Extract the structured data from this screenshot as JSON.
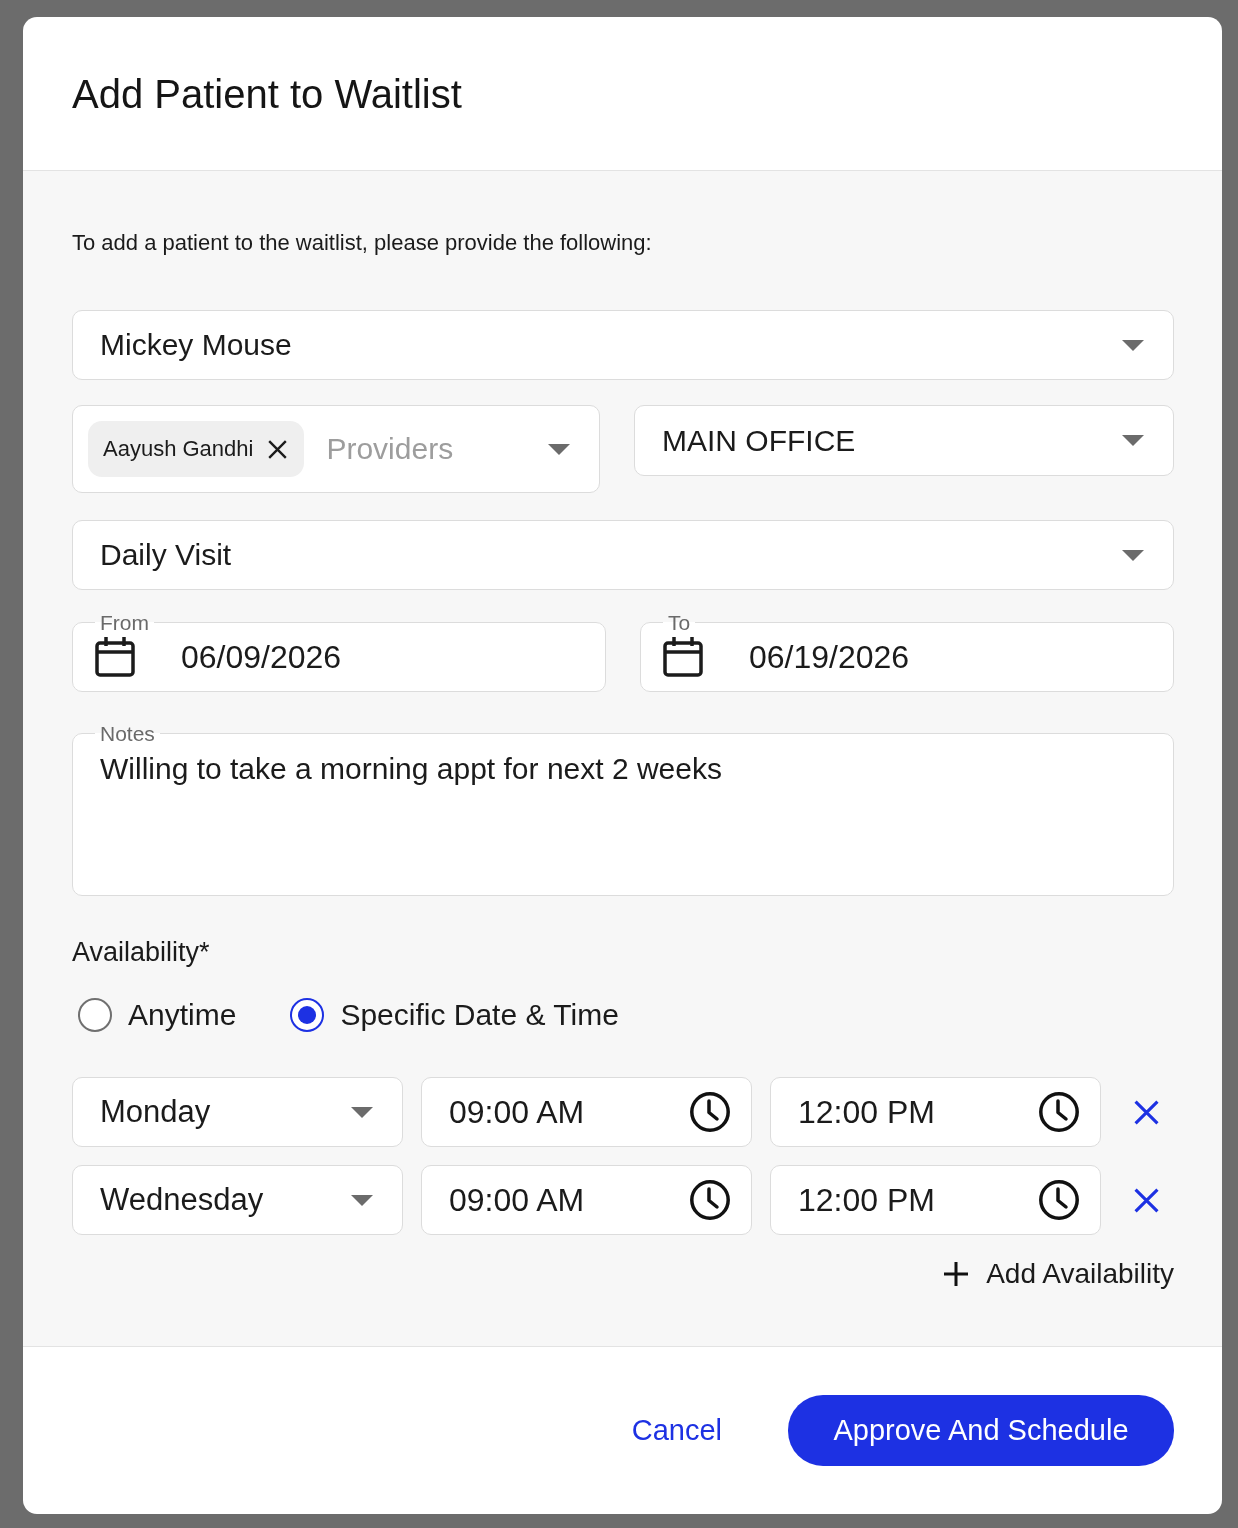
{
  "dialog": {
    "title": "Add Patient to Waitlist"
  },
  "form": {
    "intro": "To add a patient to the waitlist, please provide the following:",
    "patient": {
      "value": "Mickey Mouse"
    },
    "providers": {
      "chips": [
        {
          "label": "Aayush Gandhi"
        }
      ],
      "placeholder": "Providers"
    },
    "location": {
      "value": "MAIN OFFICE"
    },
    "visit_type": {
      "value": "Daily Visit"
    },
    "date_range": [
      {
        "label": "From",
        "value": "06/09/2026"
      },
      {
        "label": "To",
        "value": "06/19/2026"
      }
    ],
    "notes": {
      "label": "Notes",
      "value": "Willing to take a morning appt for next 2 weeks"
    }
  },
  "availability": {
    "label": "Availability*",
    "options": [
      {
        "label": "Anytime",
        "selected": false
      },
      {
        "label": "Specific Date & Time",
        "selected": true
      }
    ],
    "slots": [
      {
        "day": "Monday",
        "start": "09:00 AM",
        "end": "12:00 PM"
      },
      {
        "day": "Wednesday",
        "start": "09:00 AM",
        "end": "12:00 PM"
      }
    ],
    "add_button": "Add Availability"
  },
  "footer": {
    "buttons": [
      {
        "label": "Cancel",
        "kind": "link"
      },
      {
        "label": "Approve And Schedule",
        "kind": "primary"
      }
    ]
  }
}
